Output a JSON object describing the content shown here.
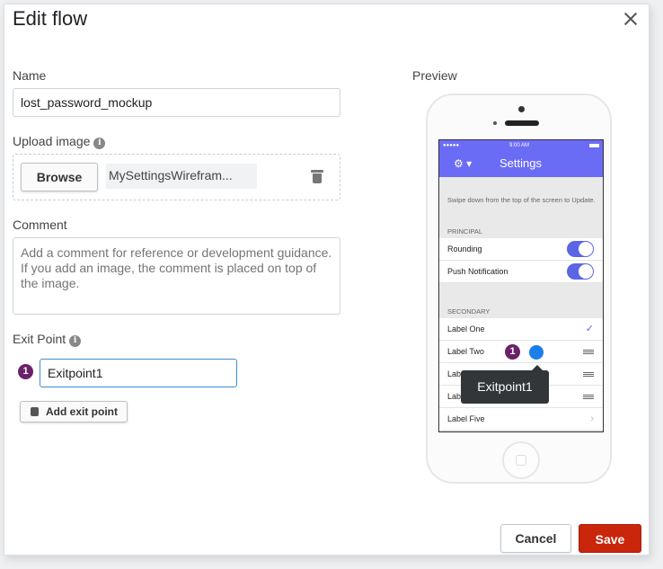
{
  "dialog": {
    "title": "Edit flow"
  },
  "name": {
    "label": "Name",
    "value": "lost_password_mockup"
  },
  "upload": {
    "label": "Upload image",
    "browse_label": "Browse",
    "filename": "MySettingsWirefram..."
  },
  "comment": {
    "label": "Comment",
    "placeholder": "Add a comment for reference or development guidance. If you add an image, the comment is placed on top of the image."
  },
  "exit_point": {
    "label": "Exit Point",
    "index": "1",
    "value": "Exitpoint1",
    "add_label": "Add exit point"
  },
  "preview": {
    "label": "Preview",
    "status_carrier": "●●●●● ",
    "status_time": "9:00 AM",
    "nav_title": "Settings",
    "nav_gear": "⚙ ▾",
    "hint": "Swipe down from the top of the screen to Update.",
    "principal_header": "PRINCIPAL",
    "principal_rows": [
      "Rounding",
      "Push Notification"
    ],
    "secondary_header": "SECONDARY",
    "secondary_rows": [
      "Label One",
      "Label Two",
      "Label Three",
      "Label Four",
      "Label Five"
    ],
    "marker_index": "1",
    "tooltip": "Exitpoint1"
  },
  "footer": {
    "cancel_label": "Cancel",
    "save_label": "Save"
  },
  "colors": {
    "accent": "#6b6cf6",
    "save": "#c9260c",
    "badge": "#6b2268",
    "marker": "#1a7fe8"
  }
}
